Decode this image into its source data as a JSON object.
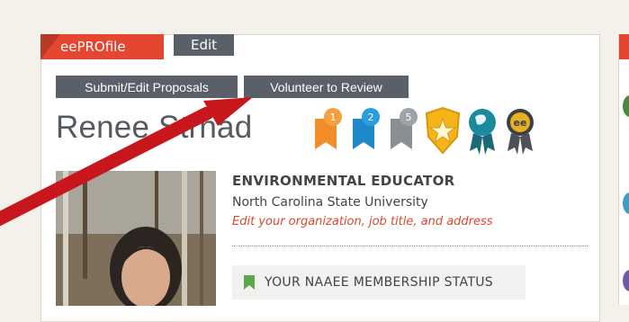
{
  "tabs": {
    "profile": "eePROfile",
    "edit": "Edit"
  },
  "buttons": {
    "submit": "Submit/Edit Proposals",
    "volunteer": "Volunteer to Review"
  },
  "profile": {
    "name": "Renee Strnad",
    "role": "ENVIRONMENTAL EDUCATOR",
    "organization": "North Carolina State University",
    "edit_link": "Edit your organization, job title, and address"
  },
  "membership": {
    "label": "YOUR NAAEE MEMBERSHIP STATUS"
  },
  "badges": [
    {
      "icon": "orange-ribbon-badge-icon",
      "label": "1",
      "color": "#f28c28"
    },
    {
      "icon": "blue-ribbon-badge-icon",
      "label": "2",
      "color": "#1e88c9"
    },
    {
      "icon": "gray-ribbon-badge-icon",
      "label": "5",
      "color": "#8a8f94"
    },
    {
      "icon": "gold-shield-star-icon",
      "label": "",
      "color": "#f4b41a"
    },
    {
      "icon": "teal-globe-medal-icon",
      "label": "",
      "color": "#1b8a9e"
    },
    {
      "icon": "ee-medal-icon",
      "label": "ee",
      "color": "#e8b020"
    }
  ],
  "colors": {
    "accent_red": "#e4462f",
    "dark_button": "#5a6068",
    "arrow": "#c8161d"
  }
}
